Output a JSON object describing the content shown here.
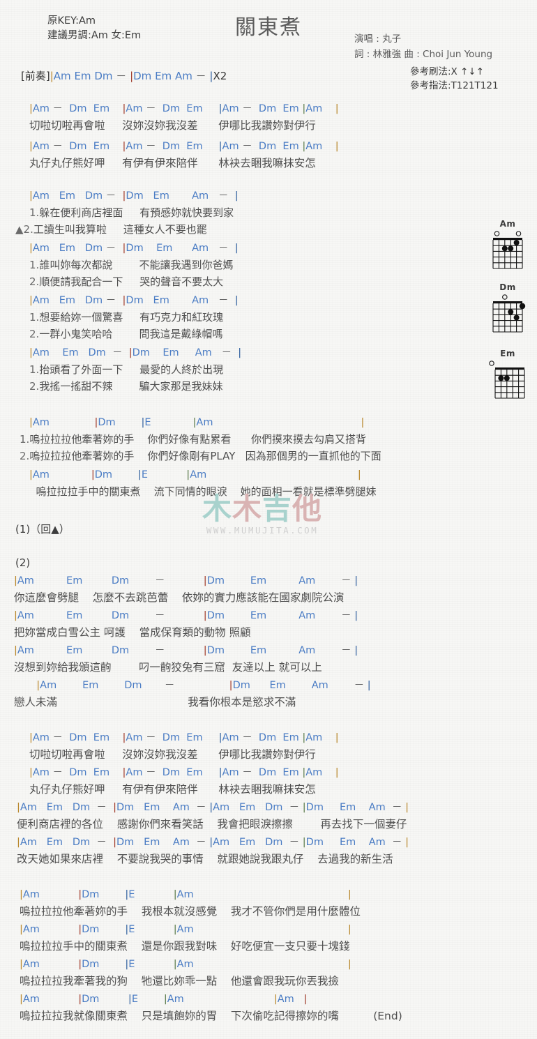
{
  "header": {
    "title": "關東煮",
    "orig_key": "原KEY:Am",
    "suggest_key": "建議男調:Am 女:Em",
    "singer": "演唱 : 丸子",
    "writers": "詞 : 林雅強   曲 : Choi Jun Young",
    "strum_ref": "參考刷法:X ↑↓↑",
    "finger_ref": "參考指法:T121T121"
  },
  "intro": {
    "label": "[前奏]",
    "chords": "|Am    Em    Dm    －  |Dm    Em    Am    －  |X2"
  },
  "colors": {
    "chord_blue": "#4a7cc4",
    "lyric_gray": "#4f4f4f",
    "bar_gold": "#b8862a",
    "bar_red": "#a03a2a",
    "bar_blue": "#2f5f9e",
    "bar_green": "#5a7a4a",
    "watermark_teal": "#a8d2cd",
    "watermark_pink": "#d9b3b3"
  },
  "verse1": [
    {
      "chords": "|Am －  Dm  Em    |Am －  Dm  Em     |Am －  Dm  Em |Am    |",
      "lyrics": "切啦切啦再會啦     沒妳沒妳我沒差      伊哪比我讚妳對伊行"
    },
    {
      "chords": "|Am －  Dm  Em    |Am －  Dm  Em     |Am －  Dm  Em |Am    |",
      "lyrics": "丸仔丸仔熊好呷     有伊有伊來陪伴      林袂去睏我嘛抹安怎"
    }
  ],
  "verse2": [
    {
      "chords": "|Am   Em   Dm －  |Dm   Em       Am   －  |",
      "l1": "1.躲在便利商店裡面     有預感妳就快要到家",
      "l2": "▲2.工讀生叫我算啦     這種女人不要也罷"
    },
    {
      "chords": "|Am   Em   Dm －  |Dm    Em      Am   －  |",
      "l1": "1.誰叫妳每次都說        不能讓我遇到你爸媽",
      "l2": "2.順便請我配合一下     哭的聲音不要太大"
    },
    {
      "chords": "|Am   Em   Dm －  |Dm   Em       Am   －  |",
      "l1": "1.想要給妳一個驚喜     有巧克力和紅玫瑰",
      "l2": "2.一群小鬼笑哈哈        問我這是戴綠帽嗎"
    },
    {
      "chords": "|Am    Em   Dm  －  |Dm    Em     Am   －  |",
      "l1": "1.抬頭看了外面一下     最愛的人終於出現",
      "l2": "2.我搖一搖甜不辣        騙大家那是我妹妹"
    }
  ],
  "chorus1": [
    {
      "chords": "|Am              |Dm        |E             |Am                                              |",
      "l1": "1.嗚拉拉拉他牽著妳的手    你們好像有點累看      你們摸來摸去勾肩又搭背",
      "l2": "2.嗚拉拉拉他牽著妳的手    你們好像剛有PLAY   因為那個男的一直抓他的下面"
    },
    {
      "chords": "|Am             |Dm        |E            |Am                                               |",
      "l1": "  嗚拉拉拉手中的關東煮    流下同情的眼淚    她的面相一看就是標準劈腿妹",
      "l2": ""
    }
  ],
  "markers": {
    "repeat1": "(1)（回▲）",
    "section2": "(2)"
  },
  "section2": [
    {
      "chords": "|Am          Em         Dm        －            |Dm        Em          Am        － |",
      "lyrics": "你這麼會劈腿    怎麼不去跳芭蕾    依妳的實力應該能在國家劇院公演"
    },
    {
      "chords": "|Am          Em         Dm        －            |Dm        Em          Am        － |",
      "lyrics": "把妳當成白雪公主 呵護    當成保育類的動物 照顧"
    },
    {
      "chords": "|Am          Em         Dm        －            |Dm        Em          Am        － |",
      "lyrics": "沒想到妳給我頒這齣        叼一齣狡兔有三窟  友達以上 就可以上"
    },
    {
      "chords": "       |Am        Em        Dm       －                 |Dm      Em        Am        － |",
      "lyrics": "戀人未滿                                      我看你根本是慾求不滿"
    }
  ],
  "verse3": [
    {
      "chords": "|Am －  Dm  Em    |Am －  Dm  Em     |Am －  Dm  Em |Am    |",
      "lyrics": "切啦切啦再會啦     沒妳沒妳我沒差      伊哪比我讚妳對伊行"
    },
    {
      "chords": "|Am －  Dm  Em    |Am －  Dm  Em     |Am －  Dm  Em |Am    |",
      "lyrics": "丸仔丸仔熊好呷     有伊有伊來陪伴      林袂去睏我嘛抹安怎"
    },
    {
      "chords": "|Am   Em   Dm  －  |Dm   Em    Am  － |Am   Em   Dm  － |Dm     Em    Am  － |",
      "lyrics": "便利商店裡的各位    感謝你們來看笑話    我會把眼淚擦擦        再去找下一個妻仔"
    },
    {
      "chords": "|Am   Em   Dm  －  |Dm   Em    Am  － |Am   Em   Dm  － |Dm     Em    Am  － |",
      "lyrics": "改天她如果來店裡    不要說我哭的事情    就跟她說我跟丸仔    去過我的新生活"
    }
  ],
  "chorus2": [
    {
      "chords": "|Am            |Dm        |E            |Am                                                |",
      "lyrics": "嗚拉拉拉他牽著妳的手    我根本就沒感覺    我才不管你們是用什麼體位"
    },
    {
      "chords": "|Am            |Dm        |E            |Am                                                |",
      "lyrics": "嗚拉拉拉手中的關東煮    還是你跟我對味    好吃便宜一支只要十塊錢"
    },
    {
      "chords": "|Am            |Dm        |E            |Am                                                |",
      "lyrics": "嗚拉拉拉我牽著我的狗    牠還比妳乖一點    他還會跟我玩你丟我撿"
    },
    {
      "chords": "|Am            |Dm         |E        |Am                            |Am   |",
      "lyrics": "嗚拉拉拉我就像關東煮    只是填飽妳的胃    下次偷吃記得擦妳的嘴          (End)"
    }
  ],
  "diagrams": [
    {
      "name": "Am",
      "open_strings": [
        1,
        4
      ],
      "muted": [],
      "dots": [
        {
          "string": 5,
          "fret": 1
        },
        {
          "string": 3,
          "fret": 2
        },
        {
          "string": 2,
          "fret": 2
        }
      ]
    },
    {
      "name": "Dm",
      "open_strings": [
        1
      ],
      "muted": [],
      "dots": [
        {
          "string": 5,
          "fret": 1
        },
        {
          "string": 3,
          "fret": 2
        },
        {
          "string": 4,
          "fret": 3
        }
      ]
    },
    {
      "name": "Em",
      "open_strings": [
        0
      ],
      "muted": [],
      "dots": [
        {
          "string": 2,
          "fret": 2
        },
        {
          "string": 3,
          "fret": 2
        }
      ]
    }
  ],
  "watermark": {
    "char1": "木",
    "char2": "木",
    "char3": "吉",
    "char4": "他",
    "url": "WWW.MUMUJITA.COM"
  },
  "end_label": "(End)"
}
